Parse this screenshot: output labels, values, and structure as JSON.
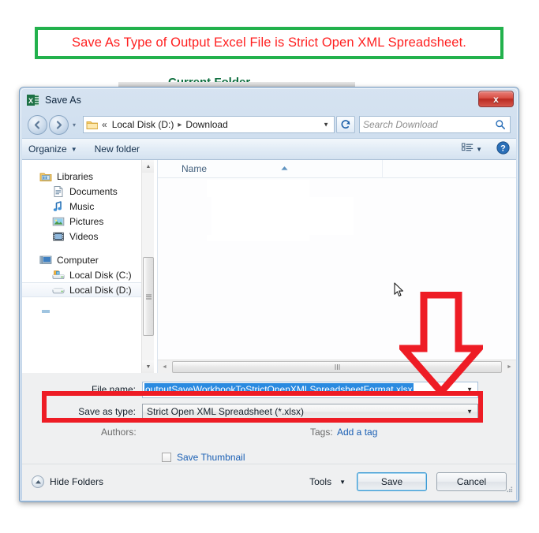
{
  "caption": {
    "text": "Save As Type of Output Excel File is Strict Open XML Spreadsheet.",
    "border_color": "#22b14c",
    "text_color": "#ff2020"
  },
  "background": {
    "current_folder_label": "Current Folder"
  },
  "dialog": {
    "title": "Save As",
    "app_icon": "excel-icon",
    "close_label": "x",
    "nav": {
      "back_icon": "back-arrow-icon",
      "forward_icon": "forward-arrow-icon",
      "history_caret": "▾",
      "address": {
        "folder_icon": "folder-icon",
        "chevrons": "«",
        "crumb1": "Local Disk (D:)",
        "separator": "▸",
        "crumb2": "Download",
        "caret": "▼"
      },
      "refresh_icon": "↻",
      "search": {
        "placeholder": "Search Download",
        "icon": "search-icon"
      }
    },
    "command_bar": {
      "organize": "Organize",
      "organize_caret": "▼",
      "new_folder": "New folder",
      "view_icon": "view-list-icon",
      "view_caret": "▼",
      "help_icon": "help-icon"
    },
    "nav_pane": {
      "items": [
        {
          "label": "Libraries",
          "icon": "libraries-icon",
          "level": 0,
          "selected": false
        },
        {
          "label": "Documents",
          "icon": "documents-icon",
          "level": 1,
          "selected": false
        },
        {
          "label": "Music",
          "icon": "music-icon",
          "level": 1,
          "selected": false
        },
        {
          "label": "Pictures",
          "icon": "pictures-icon",
          "level": 1,
          "selected": false
        },
        {
          "label": "Videos",
          "icon": "videos-icon",
          "level": 1,
          "selected": false
        },
        {
          "label": "Computer",
          "icon": "computer-icon",
          "level": 0,
          "selected": false
        },
        {
          "label": "Local Disk (C:)",
          "icon": "hard-drive-icon",
          "level": 1,
          "selected": false
        },
        {
          "label": "Local Disk (D:)",
          "icon": "hard-drive-icon",
          "level": 1,
          "selected": true
        }
      ],
      "scroll_up": "▲",
      "scroll_down": "▼"
    },
    "file_list": {
      "column_name": "Name",
      "sort_indicator": "▲",
      "rows": [],
      "hscroll_left": "◄",
      "hscroll_right": "►"
    },
    "form": {
      "filename_label": "File name:",
      "filename_value": "outputSaveWorkbookToStrictOpenXMLSpreadsheetFormat.xlsx",
      "filename_caret": "▼",
      "savetype_label": "Save as type:",
      "savetype_value": "Strict Open XML Spreadsheet (*.xlsx)",
      "savetype_caret": "▼",
      "authors_label": "Authors:",
      "authors_value": "",
      "tags_label": "Tags:",
      "tags_link": "Add a tag",
      "save_thumbnail_label": "Save Thumbnail",
      "save_thumbnail_checked": false
    },
    "footer": {
      "hide_folders_label": "Hide Folders",
      "hide_folders_icon": "collapse-icon",
      "tools_label": "Tools",
      "tools_caret": "▼",
      "save_label": "Save",
      "cancel_label": "Cancel"
    }
  },
  "annotations": {
    "arrow_color": "#ee1c25",
    "box_color": "#ee1c25",
    "arrow_target": "savetype-row",
    "box_target": "savetype-row"
  }
}
